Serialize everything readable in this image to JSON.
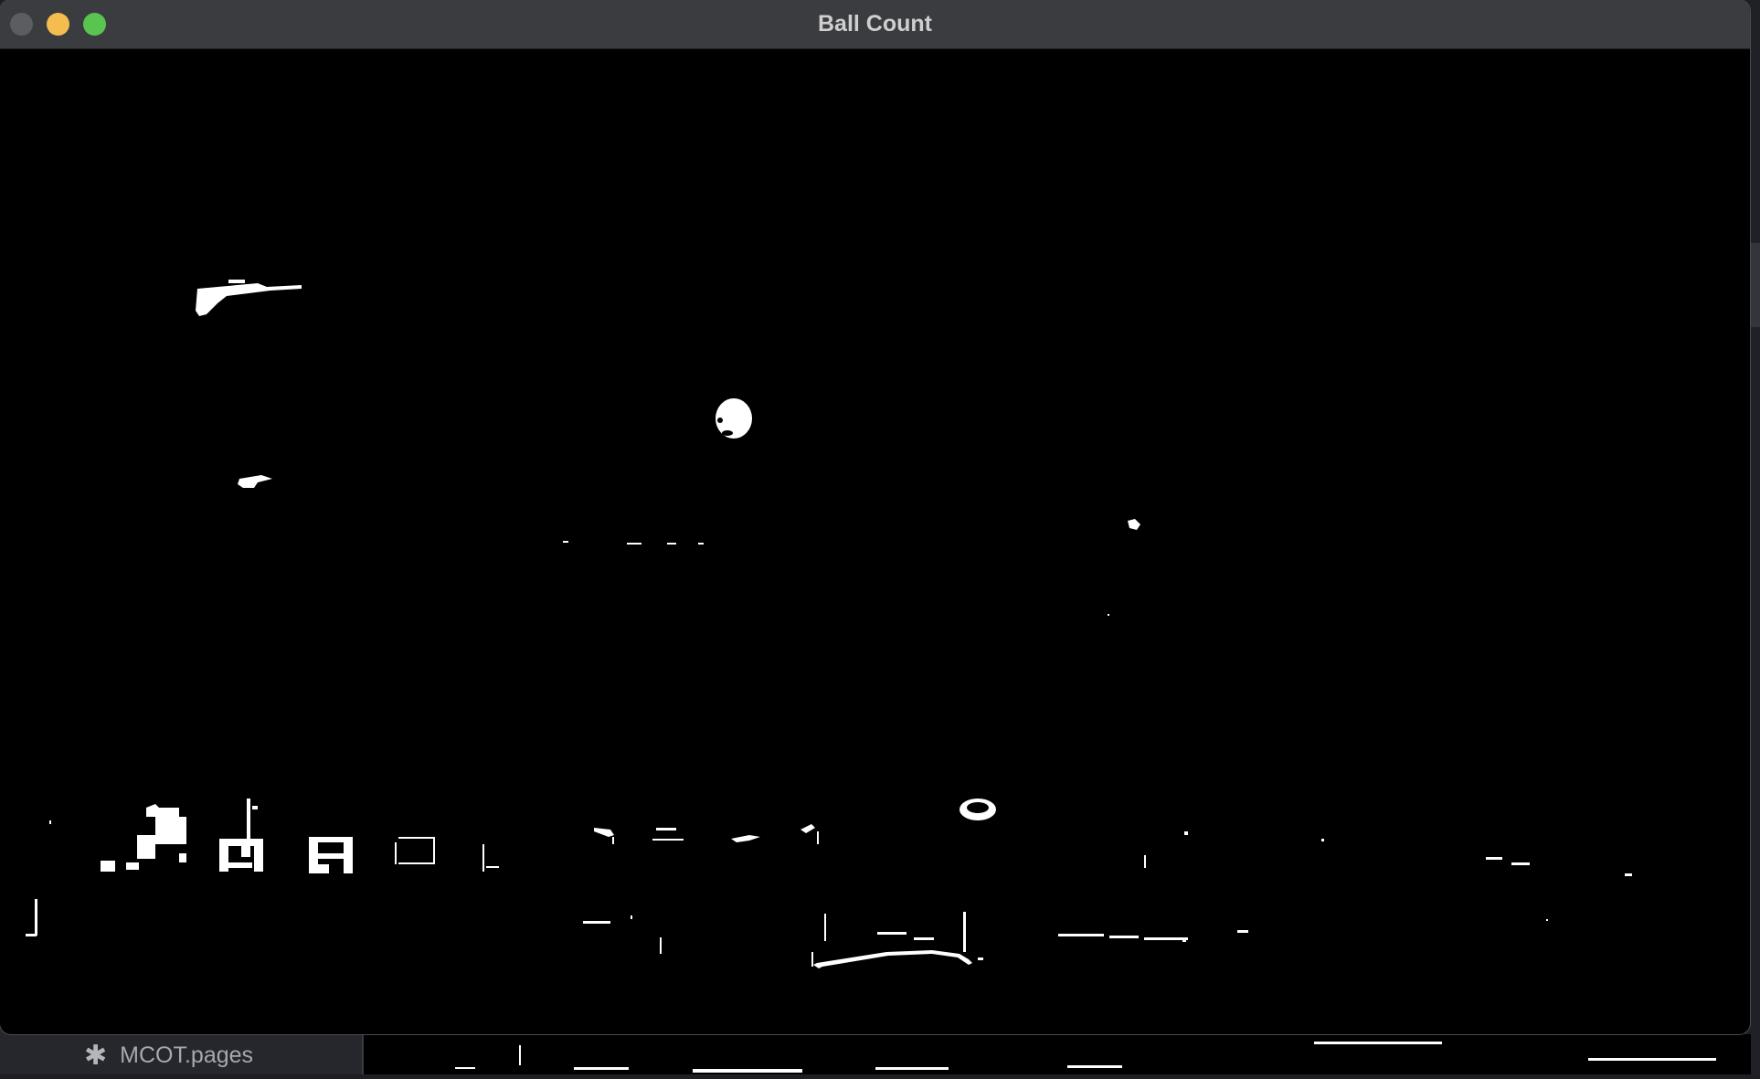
{
  "window": {
    "title": "Ball Count",
    "controls": [
      "close",
      "minimize",
      "zoom"
    ]
  },
  "background": {
    "file_label": "MCOT.pages",
    "file_icon": "asterisk-icon"
  },
  "colors": {
    "titlebar": "#3b3c3f",
    "canvas": "#000000",
    "blob": "#ffffff",
    "close": "#5c5d60",
    "minimize": "#f5bd4f",
    "zoom": "#5ac451"
  }
}
